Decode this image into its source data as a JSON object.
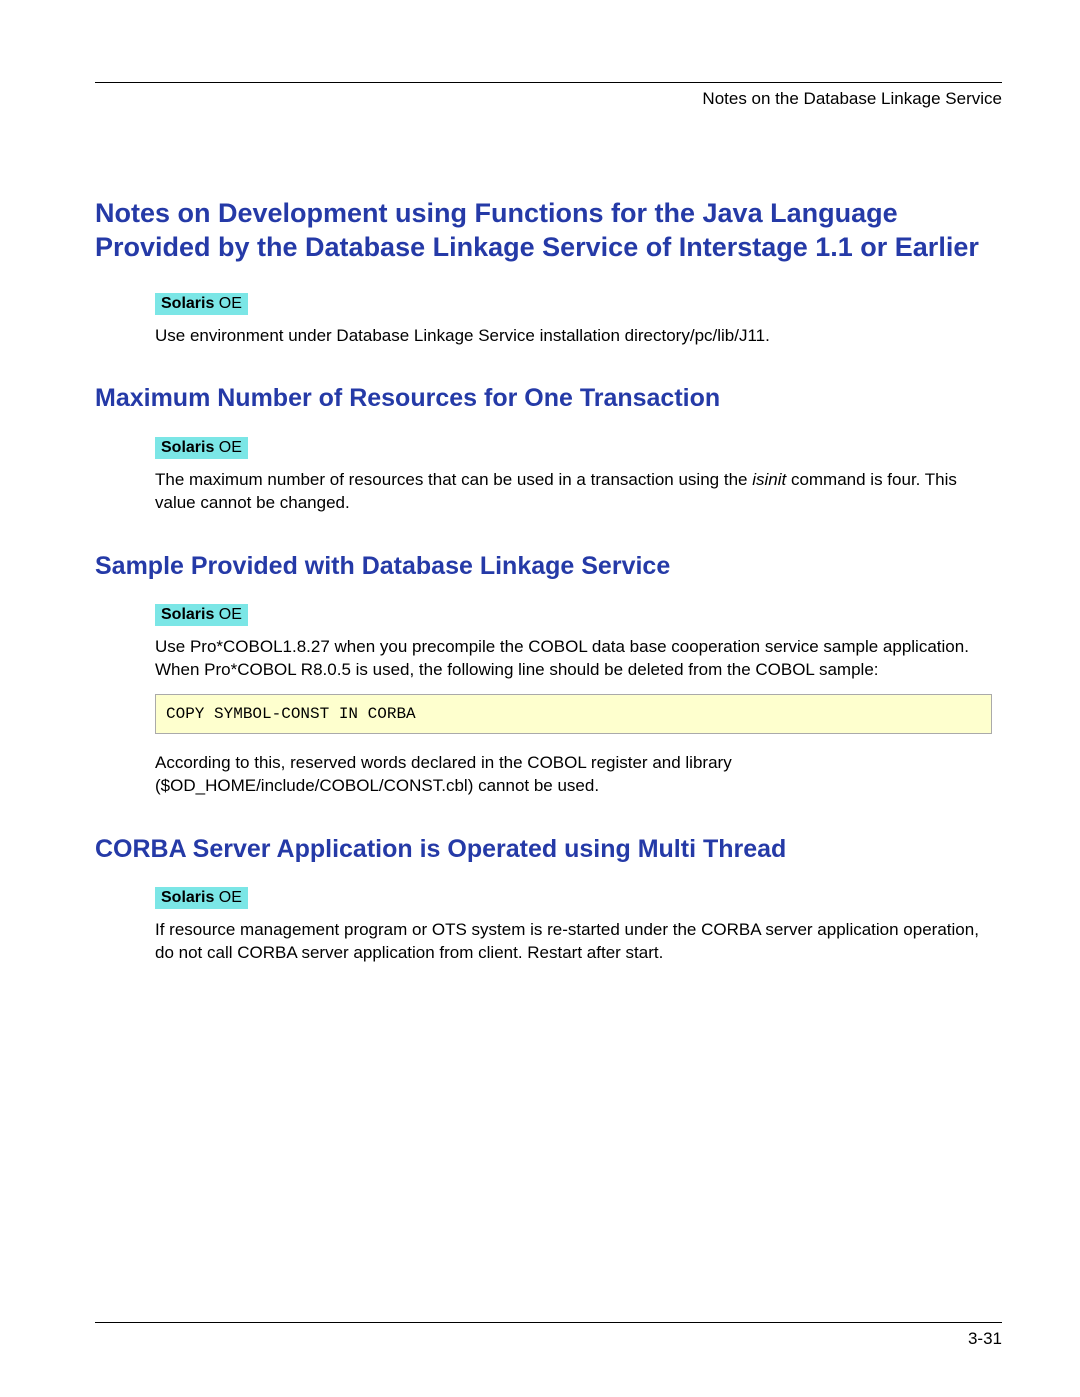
{
  "header": {
    "right_text": "Notes on the Database Linkage Service"
  },
  "footer": {
    "page_number": "3-31"
  },
  "badge_label_html": "<b>Solaris</b> OE",
  "sections": {
    "s1": {
      "heading": "Notes on Development using Functions for the Java Language Provided by the Database Linkage Service of Interstage 1.1 or Earlier",
      "body": "Use environment under Database Linkage Service installation directory/pc/lib/J11."
    },
    "s2": {
      "heading": "Maximum Number of Resources for One Transaction",
      "body_pre_italic": "The maximum number of resources that can be used in a transaction using the ",
      "body_italic": "isinit",
      "body_post_italic": " command is four. This value cannot be changed."
    },
    "s3": {
      "heading": "Sample Provided with Database Linkage Service",
      "body1": "Use Pro*COBOL1.8.27 when you precompile the COBOL data base cooperation service sample application. When Pro*COBOL R8.0.5 is used, the following line should be deleted from the COBOL sample:",
      "code": "COPY SYMBOL-CONST IN CORBA",
      "body2": "According to this, reserved words declared in the COBOL register and library ($OD_HOME/include/COBOL/CONST.cbl) cannot be used."
    },
    "s4": {
      "heading": "CORBA Server Application is Operated using Multi Thread",
      "body": "If resource management program or OTS system is re-started under the CORBA server application operation, do not call CORBA server application from client. Restart after start."
    }
  }
}
